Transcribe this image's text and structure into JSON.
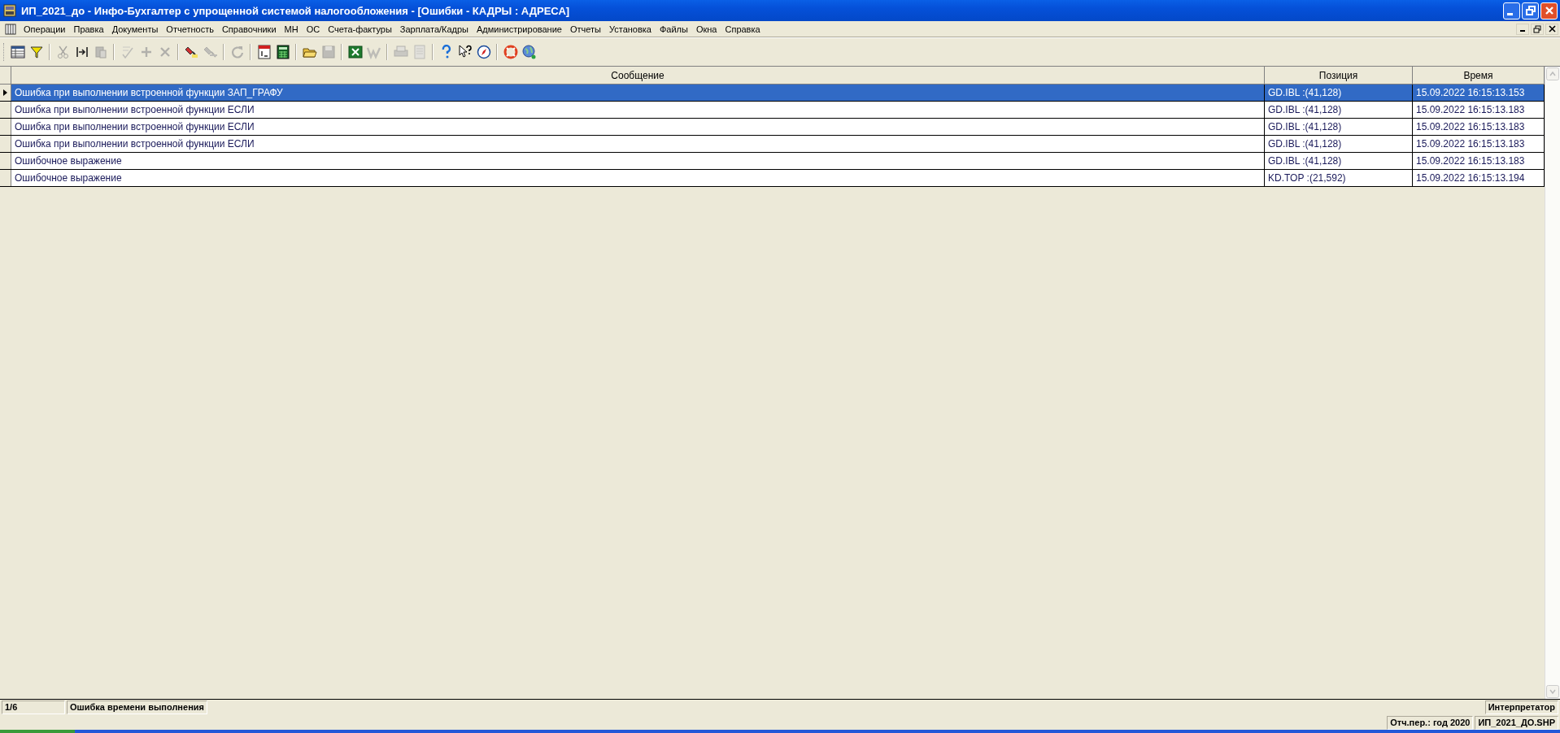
{
  "window": {
    "title": "ИП_2021_до - Инфо-Бухгалтер с упрощенной системой налогообложения - [Ошибки - КАДРЫ : АДРЕСА]"
  },
  "menu": [
    "Операции",
    "Правка",
    "Документы",
    "Отчетность",
    "Справочники",
    "МН",
    "ОС",
    "Счета-фактуры",
    "Зарплата/Кадры",
    "Администрирование",
    "Отчеты",
    "Установка",
    "Файлы",
    "Окна",
    "Справка"
  ],
  "toolbar": [
    [
      {
        "kind": "grid",
        "disabled": false
      },
      {
        "kind": "filter",
        "disabled": false
      }
    ],
    [
      {
        "kind": "scissors",
        "disabled": true
      },
      {
        "kind": "bracket",
        "disabled": false
      },
      {
        "kind": "paste",
        "disabled": true
      }
    ],
    [
      {
        "kind": "spell",
        "disabled": true
      },
      {
        "kind": "plus",
        "disabled": true
      },
      {
        "kind": "cross",
        "disabled": true
      }
    ],
    [
      {
        "kind": "marker",
        "disabled": false
      },
      {
        "kind": "marker-ab",
        "disabled": true
      }
    ],
    [
      {
        "kind": "refresh",
        "disabled": true
      }
    ],
    [
      {
        "kind": "calendar",
        "disabled": false
      },
      {
        "kind": "calculator",
        "disabled": false
      }
    ],
    [
      {
        "kind": "folder",
        "disabled": false
      },
      {
        "kind": "disk",
        "disabled": true
      }
    ],
    [
      {
        "kind": "excel",
        "disabled": false
      },
      {
        "kind": "word",
        "disabled": true
      }
    ],
    [
      {
        "kind": "printer",
        "disabled": true
      },
      {
        "kind": "page",
        "disabled": true
      }
    ],
    [
      {
        "kind": "help",
        "disabled": false
      },
      {
        "kind": "whatsthis",
        "disabled": false
      },
      {
        "kind": "compass",
        "disabled": false
      }
    ],
    [
      {
        "kind": "lifebuoy",
        "disabled": false
      },
      {
        "kind": "globe",
        "disabled": false
      }
    ]
  ],
  "table": {
    "columns": [
      "Сообщение",
      "Позиция",
      "Время"
    ],
    "rows": [
      {
        "selected": true,
        "cells": [
          "Ошибка при выполнении встроенной функции ЗАП_ГРАФУ",
          "GD.IBL :(41,128)",
          "15.09.2022 16:15:13.153"
        ]
      },
      {
        "selected": false,
        "cells": [
          "Ошибка при выполнении встроенной функции ЕСЛИ",
          "GD.IBL :(41,128)",
          "15.09.2022 16:15:13.183"
        ]
      },
      {
        "selected": false,
        "cells": [
          "Ошибка при выполнении встроенной функции ЕСЛИ",
          "GD.IBL :(41,128)",
          "15.09.2022 16:15:13.183"
        ]
      },
      {
        "selected": false,
        "cells": [
          "Ошибка при выполнении встроенной функции ЕСЛИ",
          "GD.IBL :(41,128)",
          "15.09.2022 16:15:13.183"
        ]
      },
      {
        "selected": false,
        "cells": [
          "Ошибочное выражение",
          "GD.IBL :(41,128)",
          "15.09.2022 16:15:13.183"
        ]
      },
      {
        "selected": false,
        "cells": [
          "Ошибочное выражение",
          "KD.TOP :(21,592)",
          "15.09.2022 16:15:13.194"
        ]
      }
    ]
  },
  "panel_status": {
    "counter": "1/6",
    "message": "Ошибка времени выполнения",
    "mode": "Интерпретатор"
  },
  "status_bar": {
    "period": "Отч.пер.: год 2020",
    "file": "ИП_2021_ДО.SHP"
  }
}
